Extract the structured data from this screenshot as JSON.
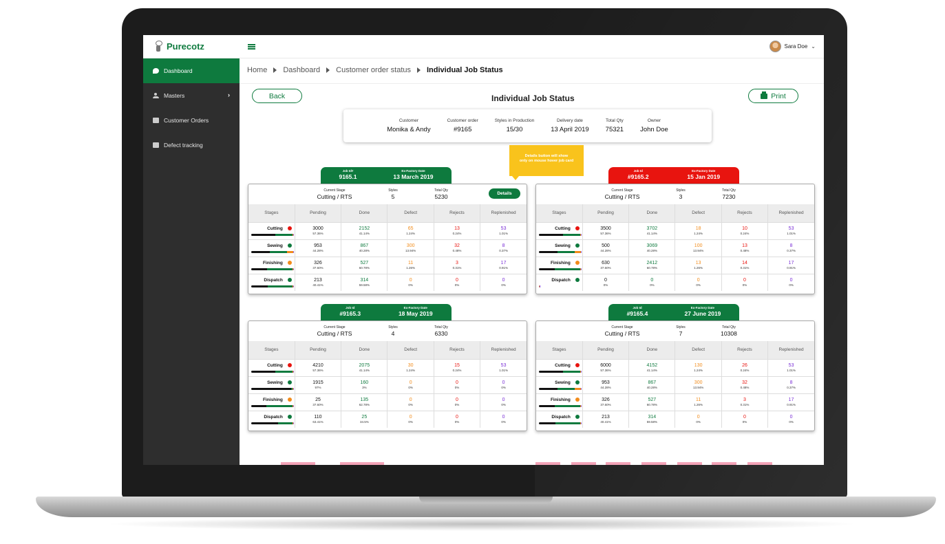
{
  "app": {
    "name": "Purecotz"
  },
  "user": {
    "name": "Sara Doe"
  },
  "sidebar": {
    "items": [
      {
        "label": "Dashboard",
        "icon": "dashboard-icon",
        "active": true
      },
      {
        "label": "Masters",
        "icon": "users-icon",
        "has_arrow": true
      },
      {
        "label": "Customer Orders",
        "icon": "orders-icon"
      },
      {
        "label": "Defect tracking",
        "icon": "defect-icon"
      }
    ]
  },
  "breadcrumb": [
    "Home",
    "Dashboard",
    "Customer order status",
    "Individual Job Status"
  ],
  "page": {
    "title": "Individual Job Status",
    "back_label": "Back",
    "print_label": "Print"
  },
  "summary": [
    {
      "label": "Customer",
      "value": "Monika & Andy"
    },
    {
      "label": "Customer order",
      "value": "#9165"
    },
    {
      "label": "Styles in Production",
      "value": "15/30"
    },
    {
      "label": "Delivery date",
      "value": "13 April 2019"
    },
    {
      "label": "Total Qty",
      "value": "75321"
    },
    {
      "label": "Owner",
      "value": "John Doe"
    }
  ],
  "tooltip": {
    "line1": "Details button will show",
    "line2": "only on mouse hover job card"
  },
  "table_headers": [
    "Stages",
    "Pending",
    "Done",
    "Defect",
    "Rejects",
    "Replenished"
  ],
  "colors": {
    "green": "#0e7a3e",
    "red": "#e8140f",
    "orange": "#f28c1b",
    "purple": "#7a2fd6",
    "yellow": "#f9c31c"
  },
  "jobs": [
    {
      "tab_color": "green",
      "id_label": "Job Id#",
      "id": "9165.1",
      "date_label": "Ex-Factory Date",
      "date": "13 March 2019",
      "stage_label": "Current Stage",
      "stage": "Cutting / RTS",
      "styles_label": "Styles",
      "styles": "5",
      "qty_label": "Total Qty",
      "qty": "5230",
      "details_label": "Details",
      "rows": [
        {
          "stage": "Cutting",
          "dot": "red",
          "pending": "3000",
          "pending_pct": "57.36%",
          "done": "2152",
          "done_pct": "41.14%",
          "defect": "65",
          "defect_pct": "1.24%",
          "rejects": "13",
          "rejects_pct": "0.24%",
          "replenished": "53",
          "replenished_pct": "1.01%"
        },
        {
          "stage": "Sewing",
          "dot": "green",
          "pending": "953",
          "pending_pct": "44.28%",
          "done": "867",
          "done_pct": "40.28%",
          "defect": "300",
          "defect_pct": "13.94%",
          "rejects": "32",
          "rejects_pct": "0.48%",
          "replenished": "8",
          "replenished_pct": "0.37%"
        },
        {
          "stage": "Finishing",
          "dot": "orange",
          "pending": "326",
          "pending_pct": "37.60%",
          "done": "527",
          "done_pct": "60.78%",
          "defect": "11",
          "defect_pct": "1.26%",
          "rejects": "3",
          "rejects_pct": "0.31%",
          "replenished": "17",
          "replenished_pct": "0.91%"
        },
        {
          "stage": "Dispatch",
          "dot": "green",
          "pending": "213",
          "pending_pct": "40.41%",
          "done": "314",
          "done_pct": "59.58%",
          "defect": "0",
          "defect_pct": "0%",
          "rejects": "0",
          "rejects_pct": "0%",
          "replenished": "0",
          "replenished_pct": "0%"
        }
      ]
    },
    {
      "tab_color": "red",
      "id_label": "Job Id",
      "id": "#9165.2",
      "date_label": "Ex-Factory Date",
      "date": "15 Jan 2019",
      "stage_label": "Current Stage",
      "stage": "Cutting / RTS",
      "styles_label": "Styles",
      "styles": "3",
      "qty_label": "Total Qty",
      "qty": "7230",
      "rows": [
        {
          "stage": "Cutting",
          "dot": "red",
          "pending": "3500",
          "pending_pct": "57.36%",
          "done": "3702",
          "done_pct": "41.14%",
          "defect": "18",
          "defect_pct": "1.24%",
          "rejects": "10",
          "rejects_pct": "0.24%",
          "replenished": "53",
          "replenished_pct": "1.01%"
        },
        {
          "stage": "Sewing",
          "dot": "green",
          "pending": "500",
          "pending_pct": "44.28%",
          "done": "3069",
          "done_pct": "40.28%",
          "defect": "100",
          "defect_pct": "13.94%",
          "rejects": "13",
          "rejects_pct": "0.48%",
          "replenished": "8",
          "replenished_pct": "0.37%"
        },
        {
          "stage": "Finishing",
          "dot": "orange",
          "pending": "630",
          "pending_pct": "37.60%",
          "done": "2412",
          "done_pct": "60.78%",
          "defect": "13",
          "defect_pct": "1.26%",
          "rejects": "14",
          "rejects_pct": "0.31%",
          "replenished": "17",
          "replenished_pct": "0.91%"
        },
        {
          "stage": "Dispatch",
          "dot": "green",
          "pending": "0",
          "pending_pct": "0%",
          "done": "0",
          "done_pct": "0%",
          "defect": "0",
          "defect_pct": "0%",
          "rejects": "0",
          "rejects_pct": "0%",
          "replenished": "0",
          "replenished_pct": "0%"
        }
      ]
    },
    {
      "tab_color": "green",
      "id_label": "Job Id",
      "id": "#9165.3",
      "date_label": "Ex-Factory Date",
      "date": "18 May 2019",
      "stage_label": "Current Stage",
      "stage": "Cutting / RTS",
      "styles_label": "Styles",
      "styles": "4",
      "qty_label": "Total Qty",
      "qty": "6330",
      "rows": [
        {
          "stage": "Cutting",
          "dot": "red",
          "pending": "4210",
          "pending_pct": "57.36%",
          "done": "2075",
          "done_pct": "41.14%",
          "defect": "30",
          "defect_pct": "1.24%",
          "rejects": "15",
          "rejects_pct": "0.24%",
          "replenished": "53",
          "replenished_pct": "1.01%"
        },
        {
          "stage": "Sewing",
          "dot": "green",
          "pending": "1915",
          "pending_pct": "97%",
          "done": "160",
          "done_pct": "3%",
          "defect": "0",
          "defect_pct": "0%",
          "rejects": "0",
          "rejects_pct": "0%",
          "replenished": "0",
          "replenished_pct": "0%"
        },
        {
          "stage": "Finishing",
          "dot": "orange",
          "pending": "25",
          "pending_pct": "37.60%",
          "done": "135",
          "done_pct": "62.78%",
          "defect": "0",
          "defect_pct": "0%",
          "rejects": "0",
          "rejects_pct": "0%",
          "replenished": "0",
          "replenished_pct": "0%"
        },
        {
          "stage": "Dispatch",
          "dot": "green",
          "pending": "110",
          "pending_pct": "63.41%",
          "done": "25",
          "done_pct": "34.5%",
          "defect": "0",
          "defect_pct": "0%",
          "rejects": "0",
          "rejects_pct": "0%",
          "replenished": "0",
          "replenished_pct": "0%"
        }
      ]
    },
    {
      "tab_color": "green",
      "id_label": "Job Id",
      "id": "#9165.4",
      "date_label": "Ex-Factory Date",
      "date": "27 June 2019",
      "stage_label": "Current Stage",
      "stage": "Cutting / RTS",
      "styles_label": "Styles",
      "styles": "7",
      "qty_label": "Total Qty",
      "qty": "10308",
      "rows": [
        {
          "stage": "Cutting",
          "dot": "red",
          "pending": "6000",
          "pending_pct": "57.36%",
          "done": "4152",
          "done_pct": "41.14%",
          "defect": "130",
          "defect_pct": "1.24%",
          "rejects": "26",
          "rejects_pct": "0.24%",
          "replenished": "53",
          "replenished_pct": "1.01%"
        },
        {
          "stage": "Sewing",
          "dot": "green",
          "pending": "953",
          "pending_pct": "44.28%",
          "done": "867",
          "done_pct": "40.28%",
          "defect": "300",
          "defect_pct": "13.94%",
          "rejects": "32",
          "rejects_pct": "0.48%",
          "replenished": "8",
          "replenished_pct": "0.37%"
        },
        {
          "stage": "Finishing",
          "dot": "orange",
          "pending": "326",
          "pending_pct": "37.60%",
          "done": "527",
          "done_pct": "60.78%",
          "defect": "11",
          "defect_pct": "1.26%",
          "rejects": "3",
          "rejects_pct": "0.31%",
          "replenished": "17",
          "replenished_pct": "0.91%"
        },
        {
          "stage": "Dispatch",
          "dot": "green",
          "pending": "213",
          "pending_pct": "40.41%",
          "done": "314",
          "done_pct": "59.58%",
          "defect": "0",
          "defect_pct": "0%",
          "rejects": "0",
          "rejects_pct": "0%",
          "replenished": "0",
          "replenished_pct": "0%"
        }
      ]
    }
  ]
}
